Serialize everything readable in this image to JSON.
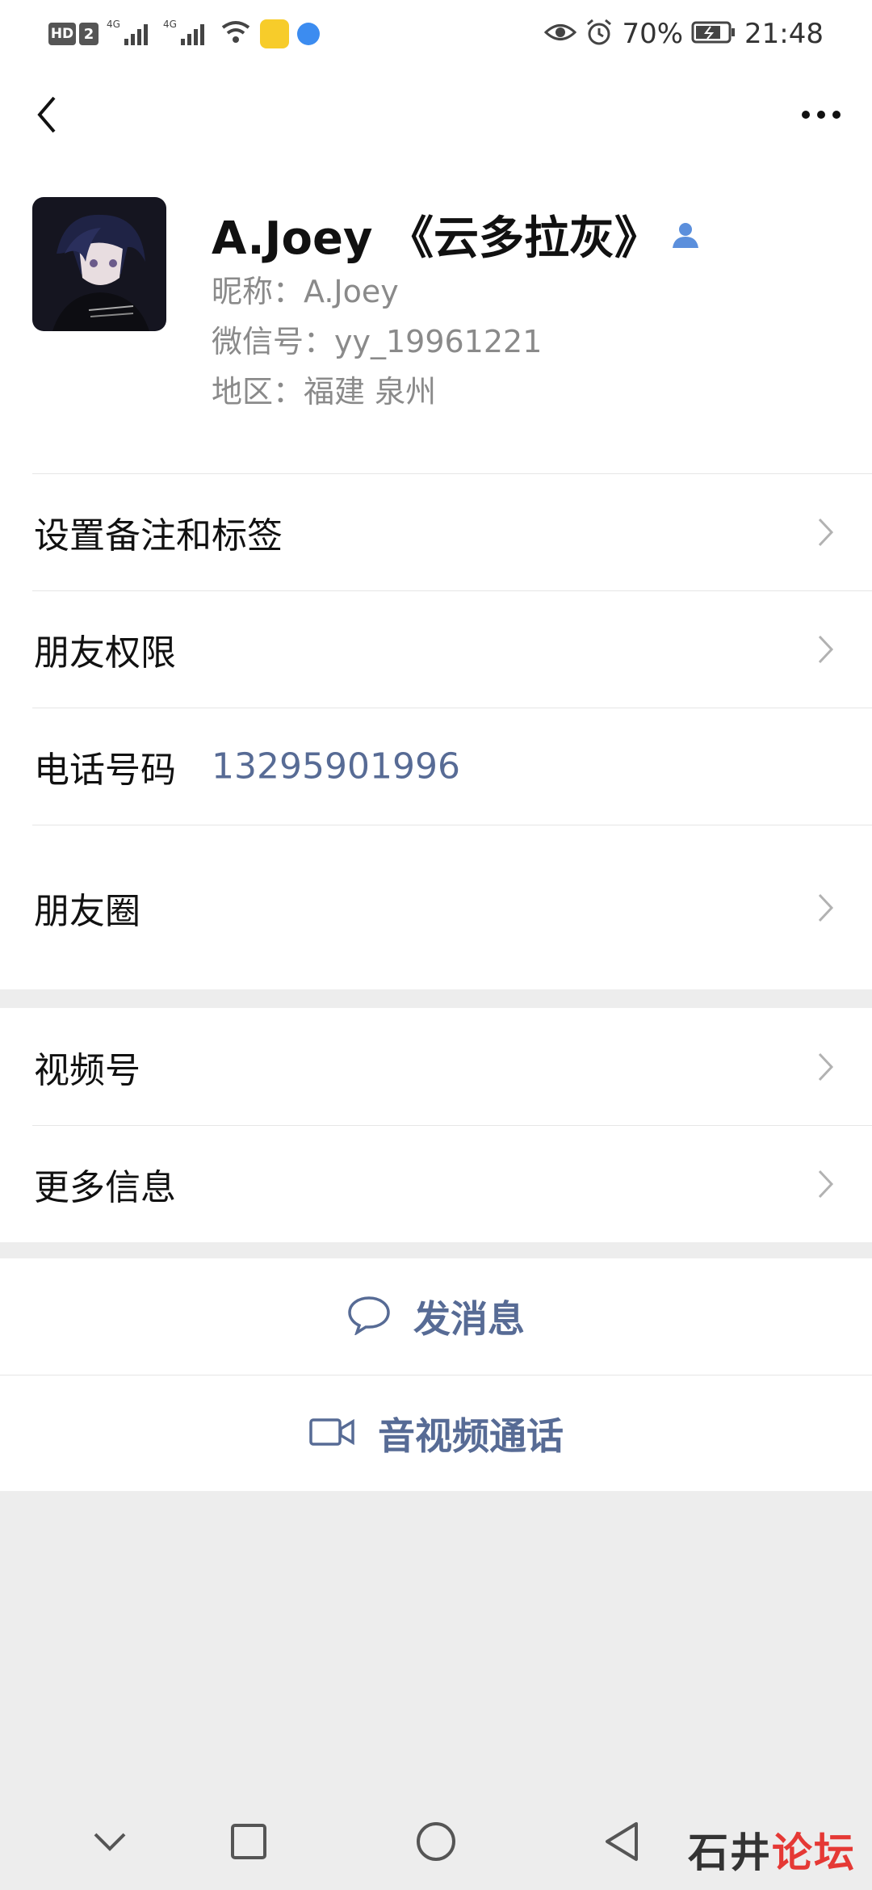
{
  "status_bar": {
    "hd_label": "HD",
    "sim_badge": "2",
    "network_1": "4G",
    "network_2": "4G",
    "battery": "70%",
    "time": "21:48"
  },
  "profile": {
    "name": "A.Joey 《云多拉灰》",
    "nickname": "昵称：A.Joey",
    "wechat_id": "微信号：yy_19961221",
    "region": "地区：福建  泉州"
  },
  "menu": {
    "remark_label": "设置备注和标签",
    "permissions_label": "朋友权限",
    "phone_label": "电话号码",
    "phone_value": "13295901996",
    "moments_label": "朋友圈",
    "channels_label": "视频号",
    "more_info_label": "更多信息"
  },
  "actions": {
    "message_label": "发消息",
    "call_label": "音视频通话"
  },
  "watermark": {
    "part1": "石井",
    "part2": "论坛"
  },
  "colors": {
    "link_blue": "#576b95",
    "background": "#ededed",
    "verified_blue": "#5b8fdc"
  }
}
